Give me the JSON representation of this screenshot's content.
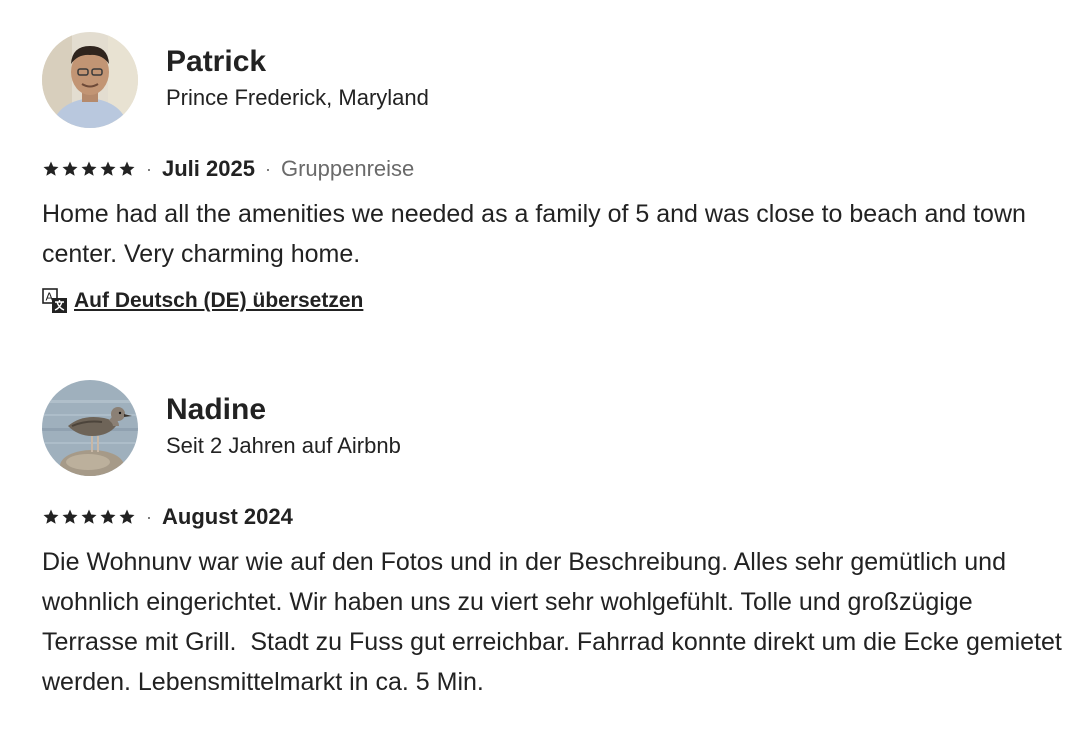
{
  "reviews": [
    {
      "name": "Patrick",
      "subtitle": "Prince Frederick, Maryland",
      "rating": 5,
      "date": "Juli 2025",
      "trip_type": "Gruppenreise",
      "text": "Home had all the amenities we needed as a family of 5 and was close to beach and town center. Very charming home.",
      "translate_label": "Auf Deutsch (DE) übersetzen",
      "avatar_icon": "person-photo"
    },
    {
      "name": "Nadine",
      "subtitle": "Seit 2 Jahren auf Airbnb",
      "rating": 5,
      "date": "August 2024",
      "text": "Die Wohnunv war wie auf den Fotos und in der Beschreibung. Alles sehr gemütlich und wohnlich eingerichtet. Wir haben uns zu viert sehr wohlgefühlt. Tolle und großzügige Terrasse mit Grill.  Stadt zu Fuss gut erreichbar. Fahrrad konnte direkt um die Ecke gemietet werden. Lebensmittelmarkt in ca. 5 Min.",
      "avatar_icon": "seagull-photo"
    }
  ],
  "colors": {
    "text": "#222222",
    "muted": "#6a6a6a",
    "star": "#222222"
  }
}
